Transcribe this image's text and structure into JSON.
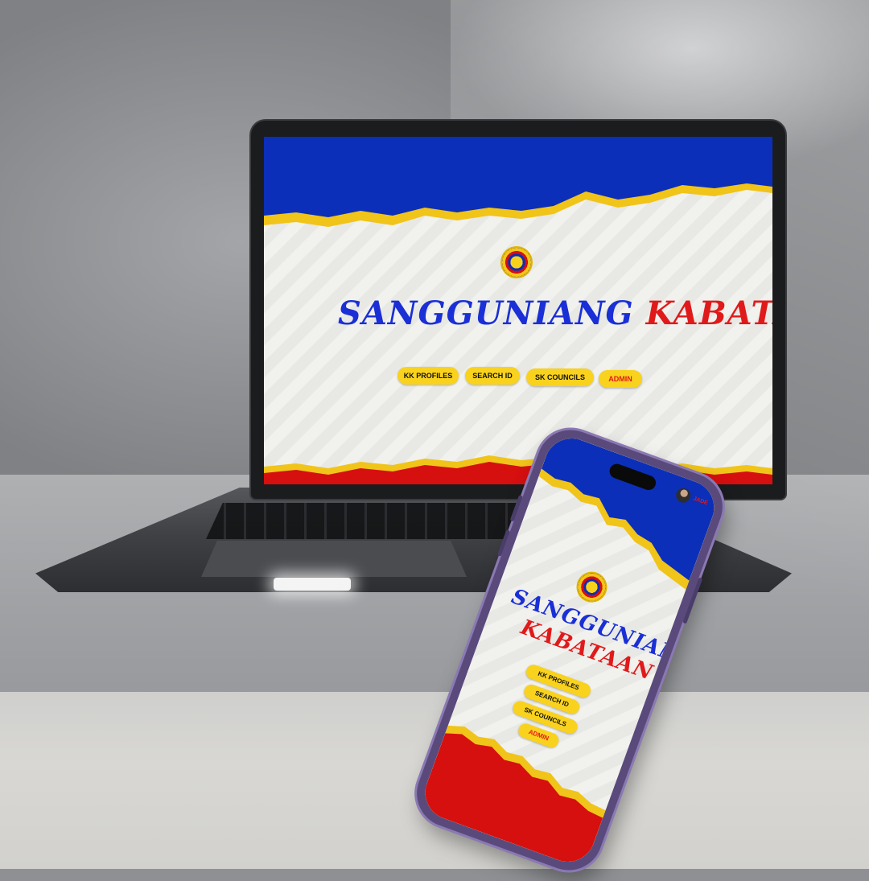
{
  "site": {
    "title_part1": "Sanggunian",
    "title_part1_suffix": "g",
    "title_part2": "Kabataan",
    "title_full_blue": "SANGGUNIANG",
    "title_full_red": "KABATAAN",
    "nav": [
      {
        "label": "KK PROFILES"
      },
      {
        "label": "SEARCH ID"
      },
      {
        "label": "SK COUNCILS"
      },
      {
        "label": "ADMIN"
      }
    ]
  },
  "phone": {
    "user_name": "JADE"
  },
  "colors": {
    "blue": "#0b2fb8",
    "red": "#d60f0f",
    "yellow": "#f9d21d",
    "title_blue": "#1a2fd6",
    "title_red": "#e01a1a"
  },
  "icons": {
    "logo": "sk-seal-icon",
    "avatar": "user-avatar-icon"
  }
}
